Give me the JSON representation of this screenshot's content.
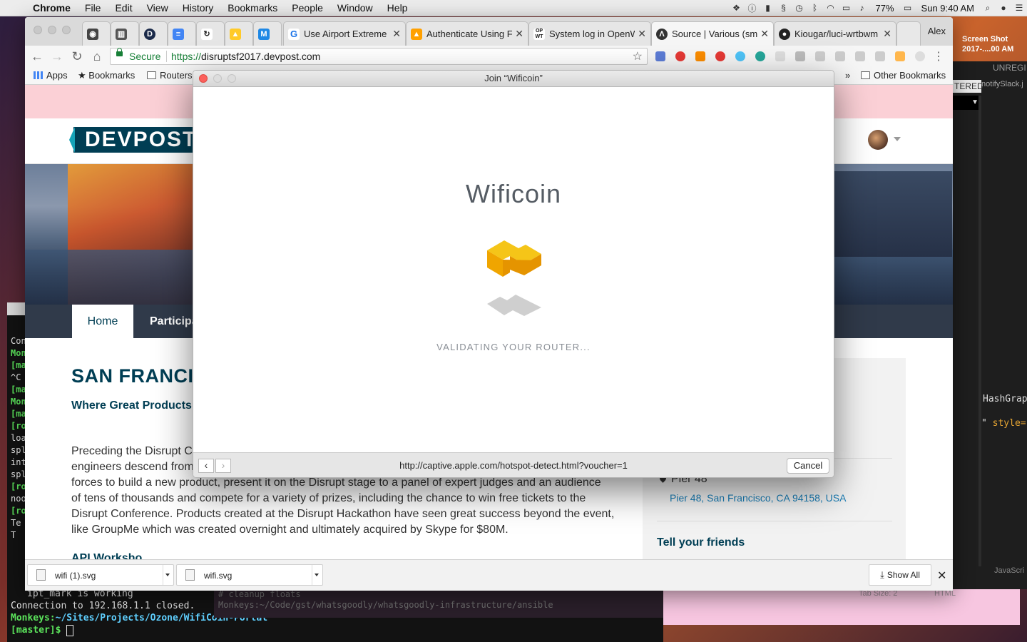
{
  "menubar": {
    "app": "Chrome",
    "items": [
      "File",
      "Edit",
      "View",
      "History",
      "Bookmarks",
      "People",
      "Window",
      "Help"
    ],
    "battery": "77%",
    "clock": "Sun 9:40 AM"
  },
  "browser": {
    "tabs": [
      {
        "title": "Use Airport Extreme",
        "favicon": "G"
      },
      {
        "title": "Authenticate Using F",
        "favicon": "firebase"
      },
      {
        "title": "System log in OpenW",
        "favicon": "OPEN"
      },
      {
        "title": "Source | Various (sm",
        "favicon": "A"
      },
      {
        "title": "Kiougar/luci-wrtbwm",
        "favicon": "github"
      }
    ],
    "pinned_tab_icons": [
      "camera-icon",
      "reader-icon",
      "D",
      "docs-icon",
      "refresh-icon",
      "flame-icon",
      "M"
    ],
    "profile": "Alex",
    "omnibox": {
      "secure_label": "Secure",
      "url_proto": "https://",
      "url_rest": "disruptsf2017.devpost.com"
    },
    "bookmarks": {
      "apps": "Apps",
      "bookmarks": "Bookmarks",
      "routers": "Routers",
      "other": "Other Bookmarks",
      "overflow": "»"
    }
  },
  "page": {
    "logo": "DEVPOST",
    "nav": {
      "home": "Home",
      "participants": "Participa"
    },
    "title": "SAN FRANCI",
    "subtitle": "Where Great Products",
    "paragraph_lines": [
      "Preceding the Disrupt C",
      "engineers descend from",
      "forces to build a new product, present it on the Disrupt stage to a panel of expert judges and an audience",
      "of tens of thousands and compete for a variety of prizes, including the chance to win free tickets to the",
      "Disrupt Conference. Products created at the Disrupt Hackathon have seen great success beyond the event,",
      "like GroupMe which was created overnight and ultimately acquired by Skype for $80M."
    ],
    "next_heading": "API Worksho",
    "sidebar": {
      "venue": "Pier 48",
      "address": "Pier 48, San Francisco, CA 94158, USA",
      "share_heading": "Tell your friends"
    }
  },
  "downloads": {
    "items": [
      {
        "name": "wifi (1).svg"
      },
      {
        "name": "wifi.svg"
      }
    ],
    "show_all": "Show All",
    "close": "✕"
  },
  "modal": {
    "title": "Join “Wificoin”",
    "brand": "Wificoin",
    "status": "VALIDATING YOUR ROUTER...",
    "url": "http://captive.apple.com/hotspot-detect.html?voucher=1",
    "back": "‹",
    "forward": "›",
    "cancel": "Cancel",
    "logo_colors": {
      "top": "#f5c518",
      "left": "#f0a500",
      "right": "#e59400",
      "shadow": "#cfcfcf"
    }
  },
  "terminal": {
    "side_lines": [
      "Con",
      "Mon",
      "[ma",
      "^C",
      "[ma",
      "Mon",
      "[ma",
      "[roo",
      "loa",
      "spl",
      "int",
      "spl",
      "[roo",
      "noo",
      "[roo",
      "Te",
      "T"
    ],
    "bottom_lines": [
      "ipt_mark is working",
      "Connection to 192.168.1.1 closed."
    ],
    "prompt_host": "Monkeys:",
    "prompt_path": "~/Sites/Projects/Ozone/WifiCoin-Portal",
    "prompt_branch": "[master]$",
    "faded_lines": [
      "# cleanup floats",
      "Monkeys:~/Code/gst/whatsgoodly/whatsgoodly-infrastructure/ansible"
    ]
  },
  "editor": {
    "unreg": "UNREGI",
    "tab": "TERED",
    "file": "notifySlack.j",
    "code1": "HashGrap",
    "code2_prefix": "\"",
    "code2_attr": "style=",
    "lang": "JavaScri",
    "tab_size": "Tab Size: 2",
    "syntax": "HTML"
  },
  "desktop": {
    "screenshot_label_1": "Screen Shot",
    "screenshot_label_2": "2017-....00 AM"
  }
}
